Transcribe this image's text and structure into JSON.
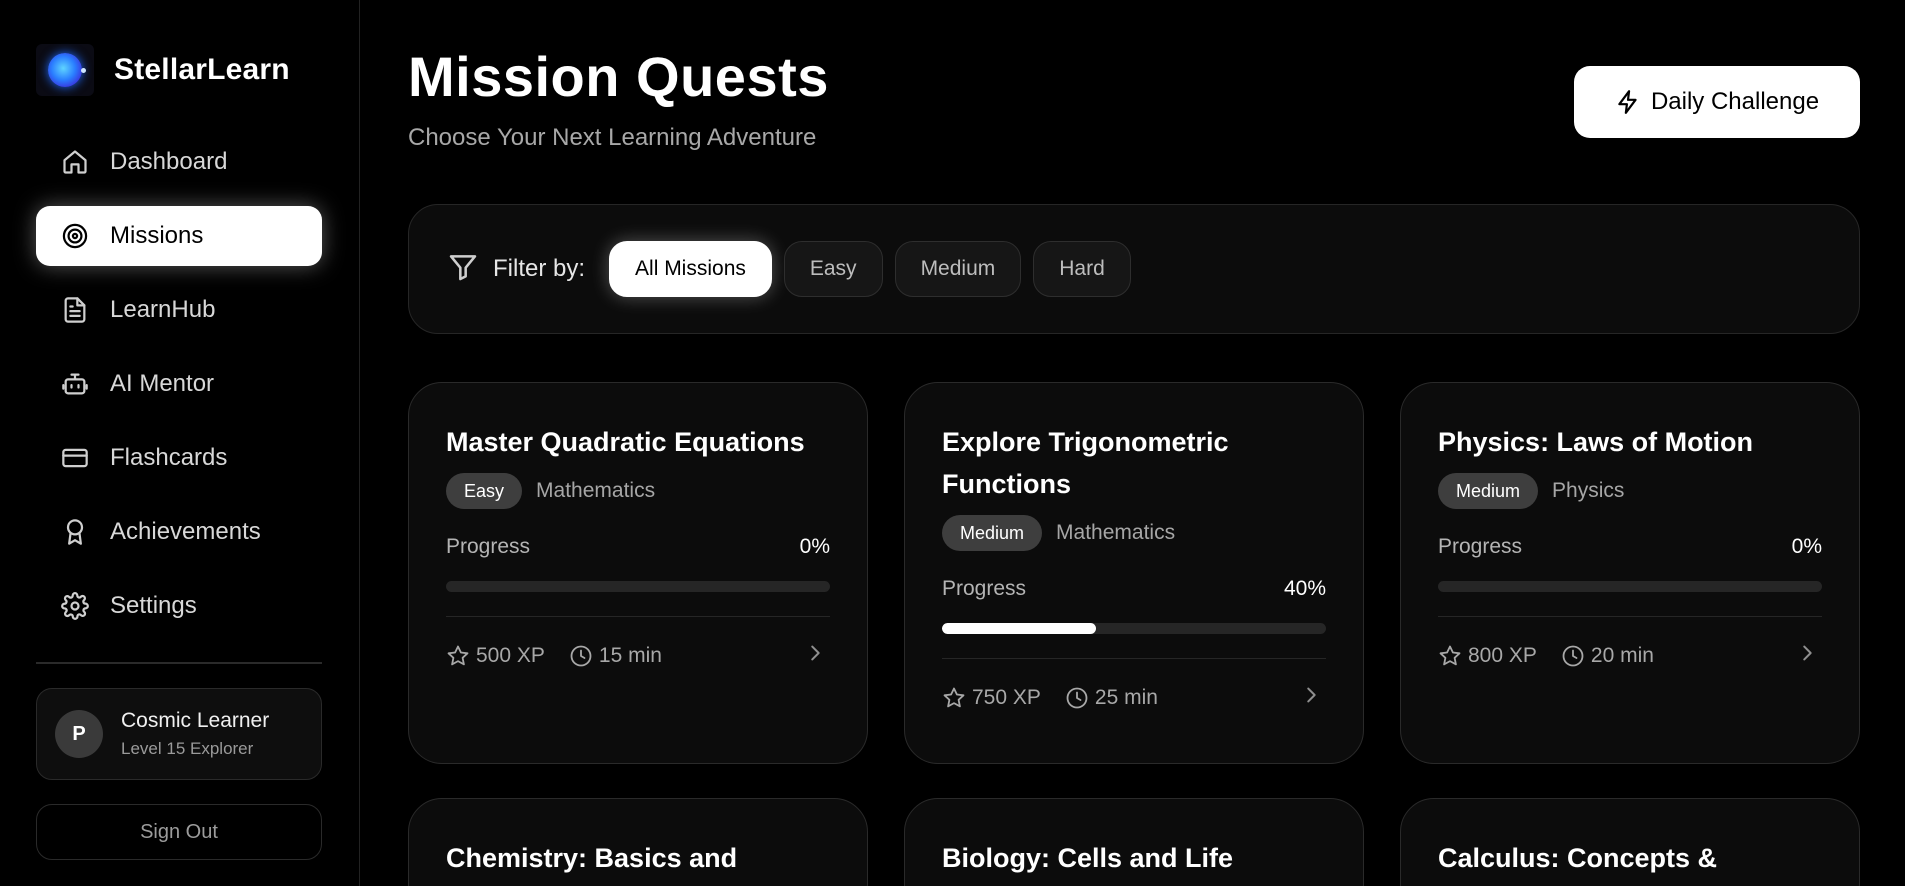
{
  "brand": {
    "name": "StellarLearn"
  },
  "sidebar": {
    "items": [
      {
        "label": "Dashboard",
        "icon": "home-icon"
      },
      {
        "label": "Missions",
        "icon": "target-icon",
        "active": true
      },
      {
        "label": "LearnHub",
        "icon": "document-icon"
      },
      {
        "label": "AI Mentor",
        "icon": "robot-icon"
      },
      {
        "label": "Flashcards",
        "icon": "card-icon"
      },
      {
        "label": "Achievements",
        "icon": "award-icon"
      },
      {
        "label": "Settings",
        "icon": "gear-icon"
      }
    ],
    "profile": {
      "initial": "P",
      "name": "Cosmic Learner",
      "level": "Level 15 Explorer"
    },
    "sign_out": "Sign Out"
  },
  "header": {
    "title": "Mission Quests",
    "subtitle": "Choose Your Next Learning Adventure",
    "daily_challenge": "Daily Challenge"
  },
  "filter": {
    "label": "Filter by:",
    "options": [
      "All Missions",
      "Easy",
      "Medium",
      "Hard"
    ],
    "selected": "All Missions"
  },
  "missions": [
    {
      "title": "Master Quadratic Equations",
      "difficulty": "Easy",
      "subject": "Mathematics",
      "progress_label": "Progress",
      "progress": "0%",
      "progress_value": 0,
      "xp": "500 XP",
      "time": "15 min"
    },
    {
      "title": "Explore Trigonometric Functions",
      "difficulty": "Medium",
      "subject": "Mathematics",
      "progress_label": "Progress",
      "progress": "40%",
      "progress_value": 40,
      "xp": "750 XP",
      "time": "25 min"
    },
    {
      "title": "Physics: Laws of Motion",
      "difficulty": "Medium",
      "subject": "Physics",
      "progress_label": "Progress",
      "progress": "0%",
      "progress_value": 0,
      "xp": "800 XP",
      "time": "20 min"
    },
    {
      "title": "Chemistry: Basics and"
    },
    {
      "title": "Biology: Cells and Life"
    },
    {
      "title": "Calculus: Concepts &"
    }
  ]
}
